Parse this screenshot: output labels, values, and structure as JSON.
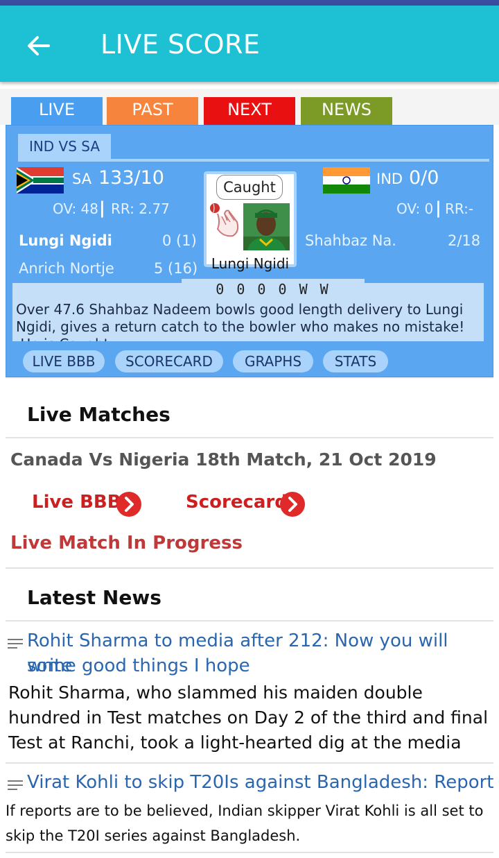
{
  "app": {
    "title": "LIVE SCORE",
    "colors": {
      "appbar": "#1ec1d4",
      "statusbar": "#3a4ba0",
      "card": "#5aa6f0"
    }
  },
  "tabs": [
    {
      "label": "LIVE",
      "color": "#4a9ef0"
    },
    {
      "label": "PAST",
      "color": "#f7843c"
    },
    {
      "label": "NEXT",
      "color": "#e81010"
    },
    {
      "label": "NEWS",
      "color": "#7c9a26"
    }
  ],
  "live_card": {
    "match_tag": "IND VS SA",
    "team1": {
      "code": "SA",
      "score": "133/10",
      "overs": "OV: 48",
      "run_rate": "RR: 2.77",
      "flag": "south-africa-flag-icon"
    },
    "team2": {
      "code": "IND",
      "score": "0/0",
      "overs": "OV: 0",
      "run_rate": "RR:-",
      "flag": "india-flag-icon"
    },
    "sep": "|",
    "batsmen": [
      {
        "name": "Lungi Ngidi",
        "score": "0 (1)"
      },
      {
        "name": "Anrich Nortje",
        "score": "5 (16)"
      }
    ],
    "bowler": {
      "name": "Shahbaz Na...",
      "figures": "2/18"
    },
    "wicket": {
      "type": "Caught",
      "player": "Lungi Ngidi"
    },
    "recent_balls": "0 0 0 0 W W",
    "commentary": "Over 47.6 Shahbaz Nadeem bowls good length delivery to Lungi Ngidi, gives a return catch to the bowler who makes no mistake! .He is Caught",
    "buttons": [
      "LIVE BBB",
      "SCORECARD",
      "GRAPHS",
      "STATS"
    ]
  },
  "live_matches": {
    "heading": "Live Matches",
    "match_title": "Canada Vs Nigeria 18th Match, 21 Oct 2019",
    "live_bbb": "Live BBB",
    "scorecard": "Scorecard",
    "status": "Live Match In Progress"
  },
  "latest_news": {
    "heading": "Latest News",
    "items": [
      {
        "headline_line1": "Rohit Sharma to media after 212: Now you will write",
        "headline_line2": "some good things I hope",
        "body_line1": "Rohit Sharma, who slammed his maiden double",
        "body_line2": "hundred in Test matches on Day 2 of the third and final",
        "body_line3": "Test at Ranchi, took a light-hearted dig at the media"
      },
      {
        "headline_line1": "Virat Kohli to skip T20Is against Bangladesh: Report",
        "body_line1": "If reports are to be believed, Indian skipper Virat Kohli is all set to",
        "body_line2": "skip the T20I series against Bangladesh."
      }
    ]
  }
}
